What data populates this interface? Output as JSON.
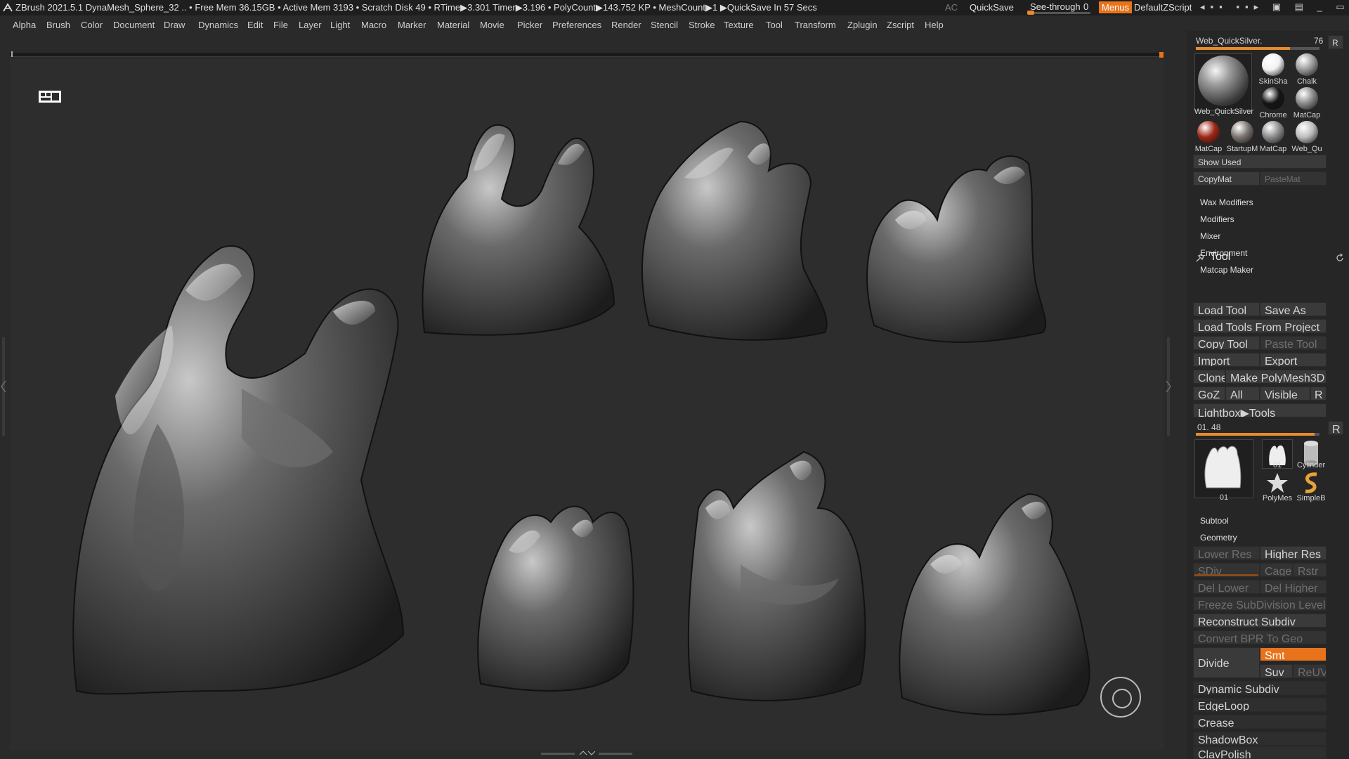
{
  "titlebar": {
    "status": "ZBrush 2021.5.1    DynaMesh_Sphere_32    .. • Free Mem 36.15GB • Active Mem 3193 • Scratch Disk 49 •  RTime▶3.301 Timer▶3.196 • PolyCount▶143.752 KP  • MeshCount▶1   ▶QuickSave In 57 Secs",
    "ac": "AC",
    "quicksave": "QuickSave",
    "see_through_label": "See-through",
    "see_through_value": "0",
    "menus": "Menus",
    "default_zscript": "DefaultZScript",
    "window_controls": "◂▪▪ ▪▪▸ ▣ ▤ _ ▭ ×"
  },
  "menubar": [
    "Alpha",
    "Brush",
    "Color",
    "Document",
    "Draw",
    "Dynamics",
    "Edit",
    "File",
    "Layer",
    "Light",
    "Macro",
    "Marker",
    "Material",
    "Movie",
    "Picker",
    "Preferences",
    "Render",
    "Stencil",
    "Stroke",
    "Texture",
    "Tool",
    "Transform",
    "Zplugin",
    "Zscript",
    "Help"
  ],
  "material": {
    "current": "Web_QuickSilver.",
    "current_value": "76",
    "current_fraction": 0.76,
    "r_label": "R",
    "big_label": "Web_QuickSilver",
    "swatches": [
      {
        "label": "SkinSha",
        "color": "#f2f2f2"
      },
      {
        "label": "Chalk",
        "color": "#9a9a9a"
      },
      {
        "label": "Chrome",
        "color": "#151515"
      },
      {
        "label": "MatCap",
        "color": "#8a8a8a"
      },
      {
        "label": "MatCap",
        "color": "#a02818"
      },
      {
        "label": "StartupM",
        "color": "#7a7470"
      },
      {
        "label": "MatCap",
        "color": "#8c8c8c"
      },
      {
        "label": "Web_Qu",
        "color": "#bdbdbd"
      }
    ],
    "show_used": "Show Used",
    "copy_mat": "CopyMat",
    "paste_mat": "PasteMat"
  },
  "sections": [
    "Wax Modifiers",
    "Modifiers",
    "Mixer",
    "Environment",
    "Matcap Maker"
  ],
  "tool": {
    "title": "Tool",
    "load_tool": "Load Tool",
    "save_as": "Save As",
    "load_tools_from_project": "Load Tools From Project",
    "copy_tool": "Copy Tool",
    "paste_tool": "Paste Tool",
    "import": "Import",
    "export": "Export",
    "clone": "Clone",
    "make_polymesh3d": "Make PolyMesh3D",
    "goz": "GoZ",
    "all": "All",
    "visible": "Visible",
    "r": "R",
    "lightbox_tools": "Lightbox▶Tools",
    "current_tool": "01. 48",
    "current_tool_fraction": 0.96,
    "thumbs": [
      {
        "label": "01"
      },
      {
        "label": "01"
      },
      {
        "label": "Cylinder"
      },
      {
        "label": "PolyMes"
      },
      {
        "label": "SimpleB"
      }
    ]
  },
  "subtool": "Subtool",
  "geometry": {
    "title": "Geometry",
    "lower_res": "Lower Res",
    "higher_res": "Higher Res",
    "sdiv": "SDiv",
    "cage": "Cage",
    "rstr": "Rstr",
    "del_lower": "Del Lower",
    "del_higher": "Del Higher",
    "freeze": "Freeze SubDivision Levels",
    "reconstruct": "Reconstruct Subdiv",
    "convert_bpr": "Convert BPR To Geo",
    "divide": "Divide",
    "smt": "Smt",
    "suv": "Suv",
    "reuv": "ReUV",
    "dynamic_subdiv": "Dynamic Subdiv",
    "edgeloop": "EdgeLoop",
    "crease": "Crease",
    "shadowbox": "ShadowBox",
    "claypolish": "ClayPolish"
  },
  "colors": {
    "accent": "#e8731a",
    "panel_bg": "#262626",
    "viewport_bg": "#2d2d2d",
    "button_bg": "#3a3a3a"
  }
}
